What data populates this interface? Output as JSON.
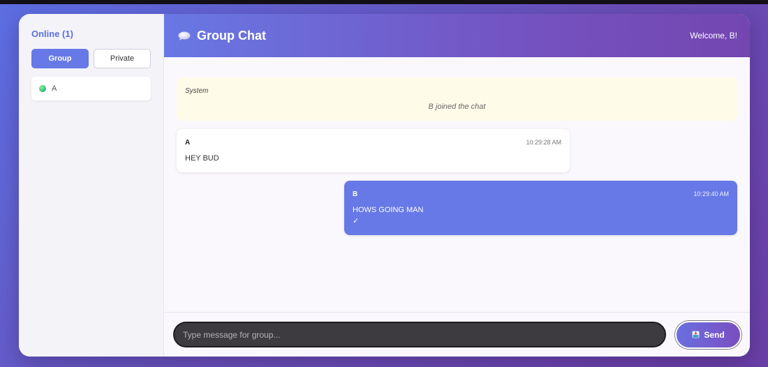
{
  "sidebar": {
    "online_title": "Online (1)",
    "tabs": [
      {
        "label": "Group",
        "active": true
      },
      {
        "label": "Private",
        "active": false
      }
    ],
    "users": [
      {
        "name": "A",
        "status": "online"
      }
    ]
  },
  "header": {
    "icon": "speech-bubble-icon",
    "title": "Group Chat",
    "welcome": "Welcome, B!"
  },
  "messages": {
    "system": {
      "label": "System",
      "text": "B joined the chat"
    },
    "items": [
      {
        "author": "A",
        "time": "10:29:28 AM",
        "text": "HEY BUD",
        "self": false
      },
      {
        "author": "B",
        "time": "10:29:40 AM",
        "text": "HOWS GOING MAN",
        "self": true,
        "check": "✓"
      }
    ]
  },
  "composer": {
    "placeholder": "Type message for group...",
    "send_label": "Send",
    "send_icon": "inbox-tray-icon"
  },
  "colors": {
    "accent": "#6679e6",
    "header_gradient_end": "#7446b0",
    "online_dot": "#22b865",
    "system_bg": "#fffbe9"
  }
}
